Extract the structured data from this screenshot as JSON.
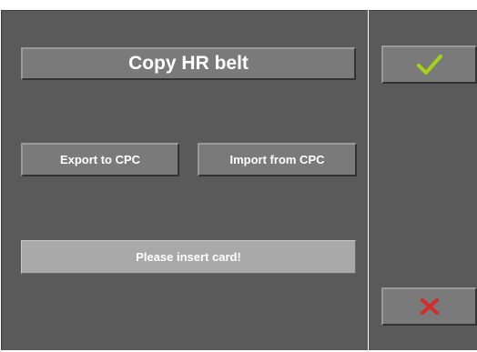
{
  "title": "Copy HR belt",
  "buttons": {
    "export_label": "Export to CPC",
    "import_label": "Import from CPC"
  },
  "status": "Please insert card!",
  "icons": {
    "confirm": "checkmark-icon",
    "cancel": "cross-icon"
  },
  "colors": {
    "panel": "#5a5a5a",
    "button": "#7a7a7a",
    "status_bg": "#a9a9a9",
    "check": "#a6d21a",
    "cross": "#d42a2a"
  }
}
